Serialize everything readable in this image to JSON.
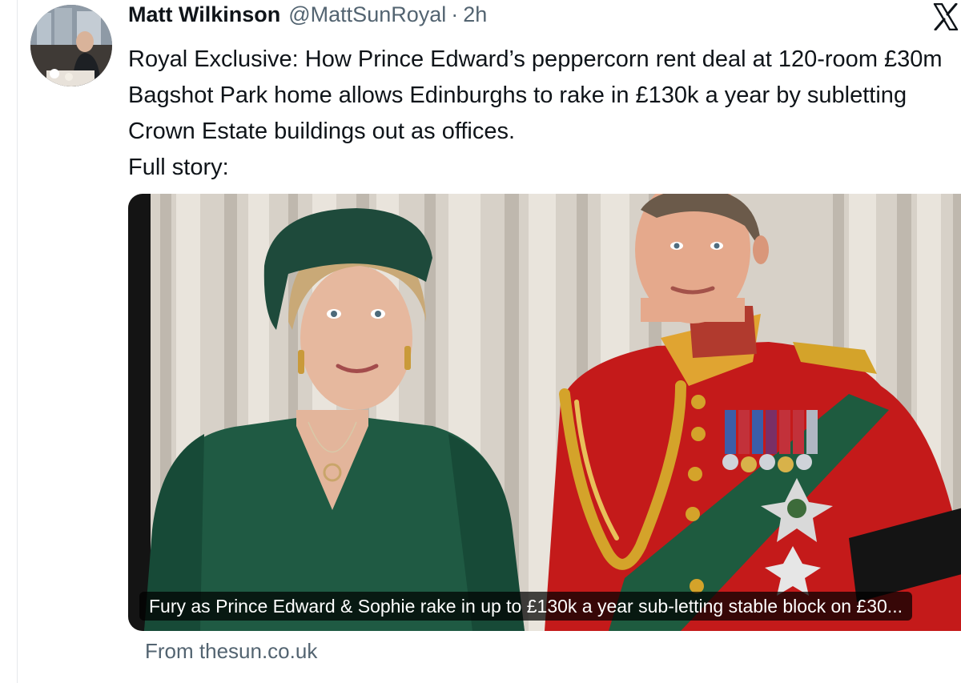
{
  "tweet": {
    "author_name": "Matt Wilkinson",
    "author_handle": "@MattSunRoyal",
    "separator": "·",
    "time_ago": "2h",
    "text_paragraph": "Royal Exclusive: How Prince Edward’s peppercorn rent deal at 120-room £30m Bagshot Park home allows Edinburghs to rake in £130k a year by subletting Crown Estate buildings out as offices.",
    "text_link_line": "Full story:"
  },
  "card": {
    "caption": "Fury as Prince Edward & Sophie rake in up to £130k a year sub-letting stable block on £30...",
    "source": "From thesun.co.uk"
  },
  "icons": {
    "platform": "x-logo-icon",
    "avatar": "author-avatar"
  },
  "colors": {
    "text_primary": "#0f1419",
    "text_secondary": "#536471",
    "dress_green": "#1f5a43",
    "tunic_red": "#c41a1a",
    "gold": "#d4a32a"
  }
}
